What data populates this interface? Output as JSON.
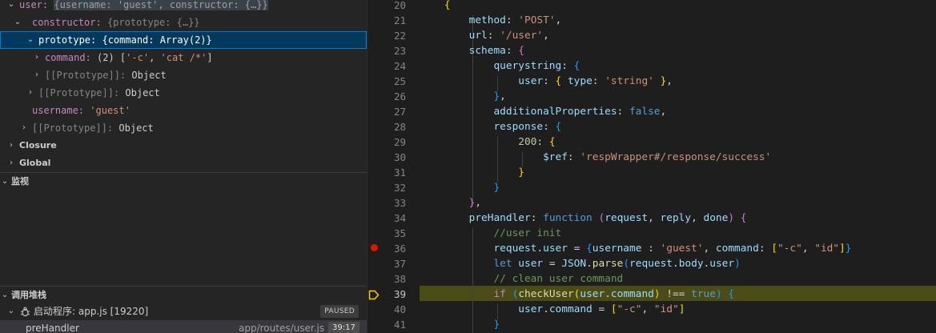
{
  "variables": {
    "user_key": "user:",
    "user_summary": "{username: 'guest', constructor: {…}}",
    "constructor_key": "constructor:",
    "constructor_value": "{prototype: {…}}",
    "prototype_key": "prototype:",
    "prototype_value": "{command: Array(2)}",
    "command_key": "command:",
    "command_value_pre": "(2) [",
    "command_item1": "'-c'",
    "command_sep": ", ",
    "command_item2": "'cat /*'",
    "command_value_post": "]",
    "proto_label": "[[Prototype]]:",
    "proto_object": "Object",
    "username_key": "username:",
    "username_value": "'guest'"
  },
  "sections": {
    "closure": "Closure",
    "global": "Global",
    "watch": "监视",
    "call_stack": "调用堆栈"
  },
  "call_stack": {
    "thread_label": "启动程序: app.js [19220]",
    "status": "PAUSED",
    "frame_name": "preHandler",
    "frame_path": "app/routes/user.js",
    "frame_pos": "39:17"
  },
  "editor": {
    "current_line": 39,
    "breakpoint_line": 36,
    "line_numbers": [
      "20",
      "21",
      "22",
      "23",
      "24",
      "25",
      "26",
      "27",
      "28",
      "29",
      "30",
      "31",
      "32",
      "33",
      "34",
      "35",
      "36",
      "37",
      "38",
      "39",
      "40",
      "41"
    ]
  },
  "colors": {
    "breakpoint": "#e51400",
    "current_line_bg": "#4b4b18",
    "selection_bg": "#04395e",
    "execution_arrow": "#ffcc00"
  },
  "icons": {
    "expanded": "chevron-down-icon",
    "collapsed": "chevron-right-icon",
    "breakpoint": "breakpoint-dot-icon",
    "current_statement": "current-statement-arrow-icon",
    "debug_thread": "bug-icon"
  }
}
